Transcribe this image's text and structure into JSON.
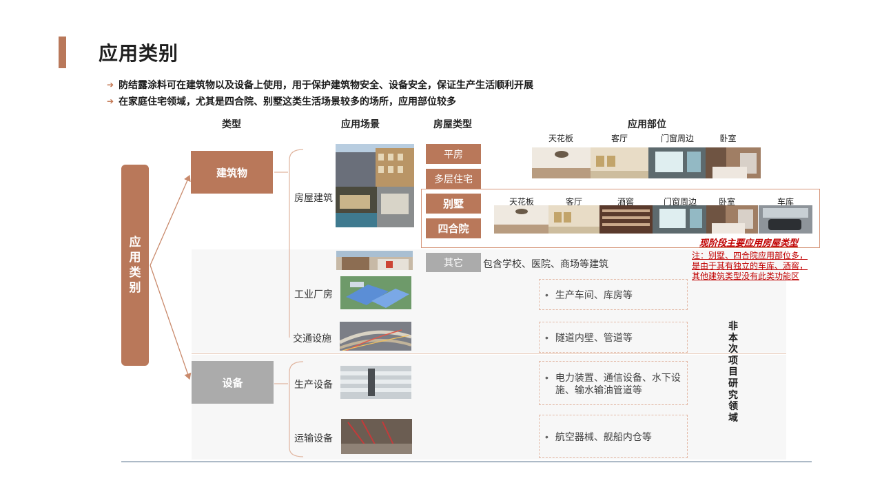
{
  "page": {
    "title": "应用类别",
    "bullets": [
      "防结露涂料可在建筑物以及设备上使用，用于保护建筑物安全、设备安全，保证生产生活顺利开展",
      "在家庭住宅领域，尤其是四合院、别墅这类生活场景较多的场所，应用部位较多"
    ]
  },
  "headers": {
    "type": "类型",
    "scene": "应用场景",
    "house_type": "房屋类型",
    "position": "应用部位"
  },
  "root": {
    "label": "应用类别",
    "chars": [
      "应",
      "用",
      "类",
      "别"
    ]
  },
  "types": {
    "building": "建筑物",
    "equipment": "设备"
  },
  "scenes": {
    "house": "房屋建筑",
    "factory": "工业厂房",
    "traffic": "交通设施",
    "production": "生产设备",
    "transport": "运输设备"
  },
  "house_types": {
    "flat": "平房",
    "multi": "多层住宅",
    "villa": "别墅",
    "courtyard": "四合院",
    "other": "其它",
    "other_desc": "包含学校、医院、商场等建筑"
  },
  "rooms_row1": [
    "天花板",
    "客厅",
    "门窗周边",
    "卧室"
  ],
  "rooms_row2": [
    "天花板",
    "客厅",
    "酒窖",
    "门窗周边",
    "卧室",
    "车库"
  ],
  "positions": {
    "factory": "生产车间、库房等",
    "traffic": "隧道内壁、管道等",
    "production_line1": "电力装置、通信设备、水下设",
    "production_line2": "施、输水输油管道等",
    "transport": "航空器械、舰船内仓等"
  },
  "highlight": {
    "title": "现阶段主要应用房屋类型",
    "note_lines": [
      "注：别墅、四合院应用部位多，",
      "是由于其有独立的车库、酒窖，",
      "其他建筑类型没有此类功能区"
    ]
  },
  "side_note": {
    "text": "非本次项目研究领域",
    "chars": [
      "非",
      "本",
      "次",
      "项",
      "目",
      "研",
      "究",
      "领",
      "域"
    ]
  },
  "colors": {
    "accent": "#b9785a",
    "grey_box": "#ababab",
    "note_red": "#c00000"
  },
  "icons": {
    "bullet": "arrow-right-icon"
  }
}
